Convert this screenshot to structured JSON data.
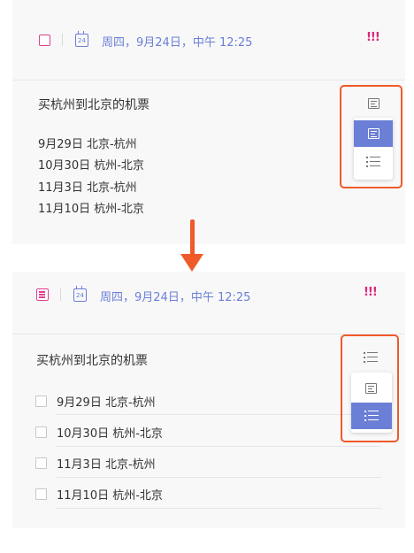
{
  "top": {
    "date": "周四，9月24日，中午 12:25",
    "priority": "!!!",
    "title": "买杭州到北京的机票",
    "lines": [
      "9月29日 北京-杭州",
      "10月30日 杭州-北京",
      "11月3日 北京-杭州",
      "11月10日 杭州-北京"
    ],
    "mode_options": [
      "text-mode",
      "checklist-mode"
    ],
    "selected_mode": "text-mode"
  },
  "bottom": {
    "date": "周四，9月24日，中午 12:25",
    "priority": "!!!",
    "title": "买杭州到北京的机票",
    "items": [
      "9月29日 北京-杭州",
      "10月30日 杭州-北京",
      "11月3日 北京-杭州",
      "11月10日 杭州-北京"
    ],
    "mode_options": [
      "text-mode",
      "checklist-mode"
    ],
    "selected_mode": "checklist-mode"
  },
  "colors": {
    "accent": "#6b7fd6",
    "priority": "#e0247a",
    "highlight": "#f05a2a"
  }
}
